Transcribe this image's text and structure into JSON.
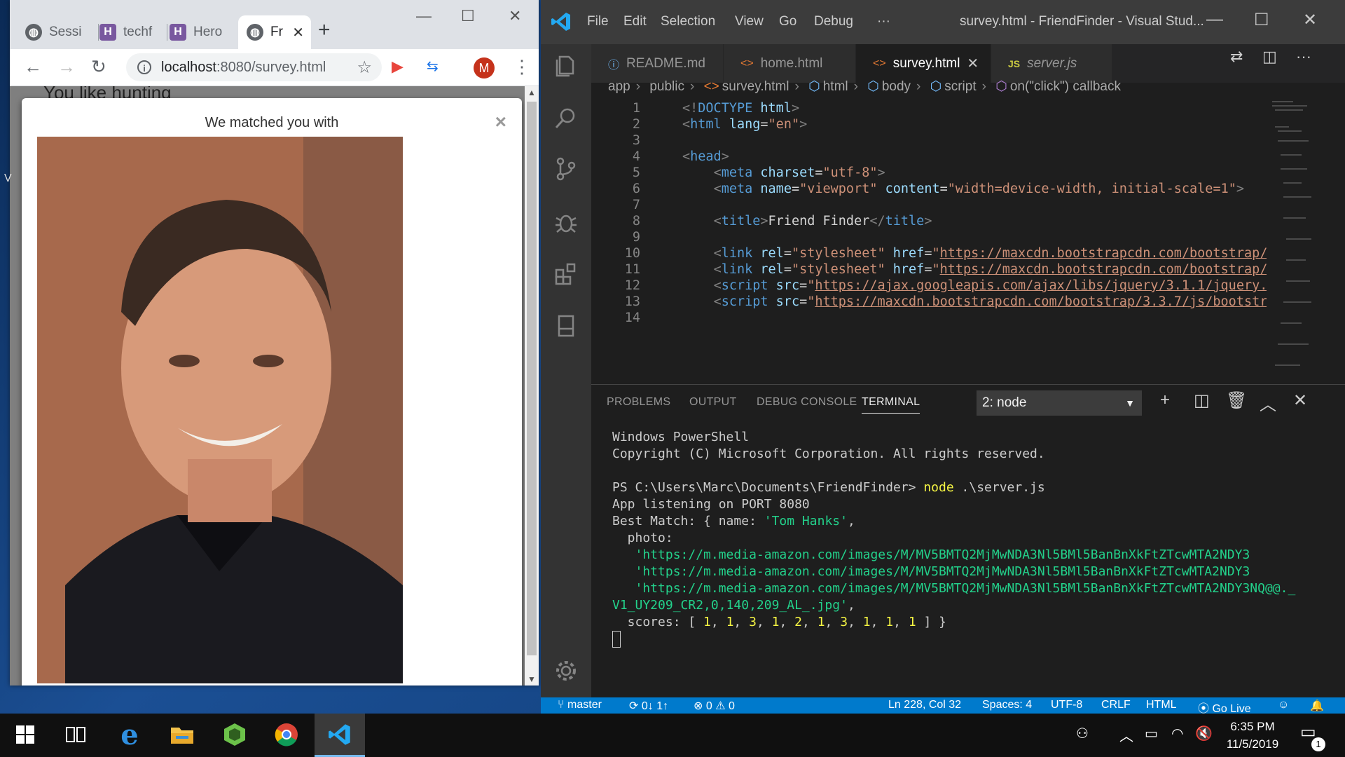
{
  "chrome": {
    "tabs": [
      {
        "label": "Sessi",
        "icon": "globe-icon"
      },
      {
        "label": "techf",
        "icon": "heroku-icon"
      },
      {
        "label": "Hero",
        "icon": "heroku-icon"
      },
      {
        "label": "Fr",
        "icon": "globe-icon",
        "active": true
      }
    ],
    "new_tab": "+",
    "url_host": "localhost",
    "url_path": ":8080/survey.html",
    "avatar_letter": "M",
    "page": {
      "background_text": "You like hunting",
      "side_letter": "V",
      "modal_title": "We matched you with",
      "modal_close": "×"
    }
  },
  "vscode": {
    "menu": [
      "File",
      "Edit",
      "Selection",
      "View",
      "Go",
      "Debug",
      "···"
    ],
    "window_title": "survey.html - FriendFinder - Visual Stud...",
    "tabs": [
      {
        "label": "README.md",
        "icon": "ⓘ"
      },
      {
        "label": "home.html",
        "icon": "<>"
      },
      {
        "label": "survey.html",
        "icon": "<>",
        "active": true
      },
      {
        "label": "server.js",
        "icon": "JS"
      }
    ],
    "breadcrumb": [
      "app",
      "public",
      "survey.html",
      "html",
      "body",
      "script",
      "on(\"click\") callback"
    ],
    "line_numbers": [
      "1",
      "2",
      "3",
      "4",
      "5",
      "6",
      "7",
      "8",
      "9",
      "10",
      "11",
      "12",
      "13",
      "14"
    ],
    "code": {
      "l8_text": "Friend Finder",
      "l10_href": "https://maxcdn.bootstrapcdn.com/bootstrap/",
      "l11_href": "https://maxcdn.bootstrapcdn.com/bootstrap/",
      "l12_src": "https://ajax.googleapis.com/ajax/libs/jquery/3.1.1/jquery.",
      "l13_src": "https://maxcdn.bootstrapcdn.com/bootstrap/3.3.7/js/bootstr"
    },
    "panel": {
      "tabs": [
        "PROBLEMS",
        "OUTPUT",
        "DEBUG CONSOLE",
        "TERMINAL"
      ],
      "terminal_select": "2: node",
      "terminal": {
        "l1": "Windows PowerShell",
        "l2": "Copyright (C) Microsoft Corporation. All rights reserved.",
        "prompt": "PS C:\\Users\\Marc\\Documents\\FriendFinder> ",
        "cmd": "node",
        "cmd_arg": " .\\server.js",
        "l4": "App listening on PORT 8080",
        "l5_pre": "Best Match: { name: ",
        "l5_name": "'Tom Hanks'",
        "l5_post": ",",
        "l6": "  photo:",
        "l7": "   'https://m.media-amazon.com/images/M/MV5BMTQ2MjMwNDA3Nl5BMl5BanBnXkFtZTcwMTA2NDY3",
        "l8": "   'https://m.media-amazon.com/images/M/MV5BMTQ2MjMwNDA3Nl5BMl5BanBnXkFtZTcwMTA2NDY3",
        "l9": "   'https://m.media-amazon.com/images/M/MV5BMTQ2MjMwNDA3Nl5BMl5BanBnXkFtZTcwMTA2NDY3NQ@@._",
        "l10": "V1_UY209_CR2,0,140,209_AL_.jpg'",
        "l10_post": ",",
        "scores_label": "  scores: [ ",
        "scores": [
          "1",
          "1",
          "3",
          "1",
          "2",
          "1",
          "3",
          "1",
          "1",
          "1"
        ],
        "scores_end": " ] }"
      }
    },
    "status": {
      "branch": "master",
      "sync": "0↓ 1↑",
      "errors": "0",
      "warnings": "0",
      "position": "Ln 228, Col 32",
      "spaces": "Spaces: 4",
      "encoding": "UTF-8",
      "eol": "CRLF",
      "language": "HTML",
      "golive": "Go Live"
    }
  },
  "taskbar": {
    "time": "6:35 PM",
    "date": "11/5/2019",
    "notifications": "1"
  }
}
